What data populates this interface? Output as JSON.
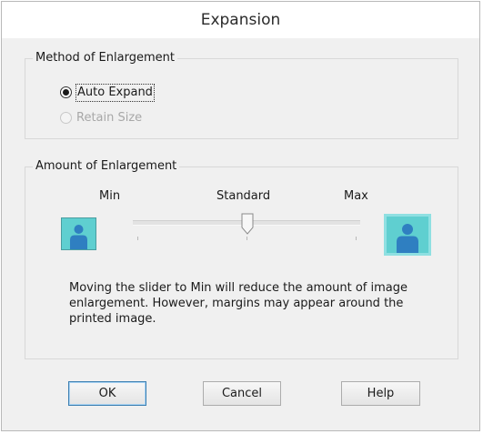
{
  "dialog": {
    "title": "Expansion"
  },
  "method_group": {
    "title": "Method of Enlargement",
    "options": [
      {
        "label": "Auto Expand",
        "selected": true,
        "enabled": true
      },
      {
        "label": "Retain Size",
        "selected": false,
        "enabled": false
      }
    ]
  },
  "amount_group": {
    "title": "Amount of Enlargement",
    "scale_labels": {
      "min": "Min",
      "standard": "Standard",
      "max": "Max"
    },
    "slider": {
      "positions": 3,
      "current_position": "Standard"
    },
    "description": "Moving the slider to Min will reduce the amount of image enlargement. However, margins may appear around the printed image."
  },
  "buttons": {
    "ok": "OK",
    "cancel": "Cancel",
    "help": "Help"
  },
  "colors": {
    "portrait_fill": "#5fcfd0",
    "person_fill": "#2f7fc1",
    "dialog_bg": "#f0f0f0"
  }
}
